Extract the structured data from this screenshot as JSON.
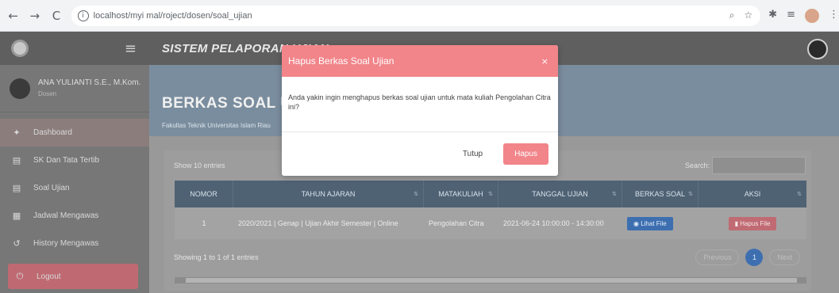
{
  "browser": {
    "url": "localhost/myi mal/roject/dosen/soal_ujian",
    "back_icon": "←",
    "forward_icon": "→",
    "reload_icon": "C"
  },
  "app": {
    "title": "SISTEM PELAPORAN UJIAN",
    "hamburger_icon": "≡"
  },
  "sidebar": {
    "user_name": "ANA YULIANTI S.E., M.Kom.",
    "user_role": "Dosen",
    "items": [
      {
        "label": "Dashboard",
        "icon": "✦"
      },
      {
        "label": "SK Dan Tata Tertib",
        "icon": "▤"
      },
      {
        "label": "Soal Ujian",
        "icon": "▤"
      },
      {
        "label": "Jadwal Mengawas",
        "icon": "▦"
      },
      {
        "label": "History Mengawas",
        "icon": "↺"
      }
    ],
    "logout_label": "Logout",
    "logout_icon": "⏻"
  },
  "page": {
    "title": "BERKAS SOAL UJIAN",
    "subtitle": "Fakultas Teknik Universitas Islam Riau"
  },
  "table": {
    "show_label": "Show  10  entries",
    "search_label": "Search:",
    "headers": [
      "NOMOR",
      "TAHUN AJARAN",
      "MATAKULIAH",
      "TANGGAL UJIAN",
      "BERKAS SOAL",
      "AKSI"
    ],
    "sort_icon": "⇅",
    "row": {
      "nomor": "1",
      "tahun_ajaran": "2020/2021 | Genap | Ujian Akhir Semester | Online",
      "matakuliah": "Pengolahan Citra",
      "tanggal": "2021-06-24 10:00:00 - 14:30:00",
      "lihat_label": "◉ Lihat File",
      "hapus_label": "▮ Hapus File"
    },
    "showing": "Showing 1 to 1 of 1 entries",
    "prev": "Previous",
    "current_page": "1",
    "next": "Next"
  },
  "modal": {
    "title": "Hapus Berkas Soal Ujian",
    "close_icon": "×",
    "body": "Anda yakin ingin menghapus berkas soal ujian untuk mata kuliah Pengolahan Citra ini?",
    "cancel_label": "Tutup",
    "confirm_label": "Hapus"
  }
}
